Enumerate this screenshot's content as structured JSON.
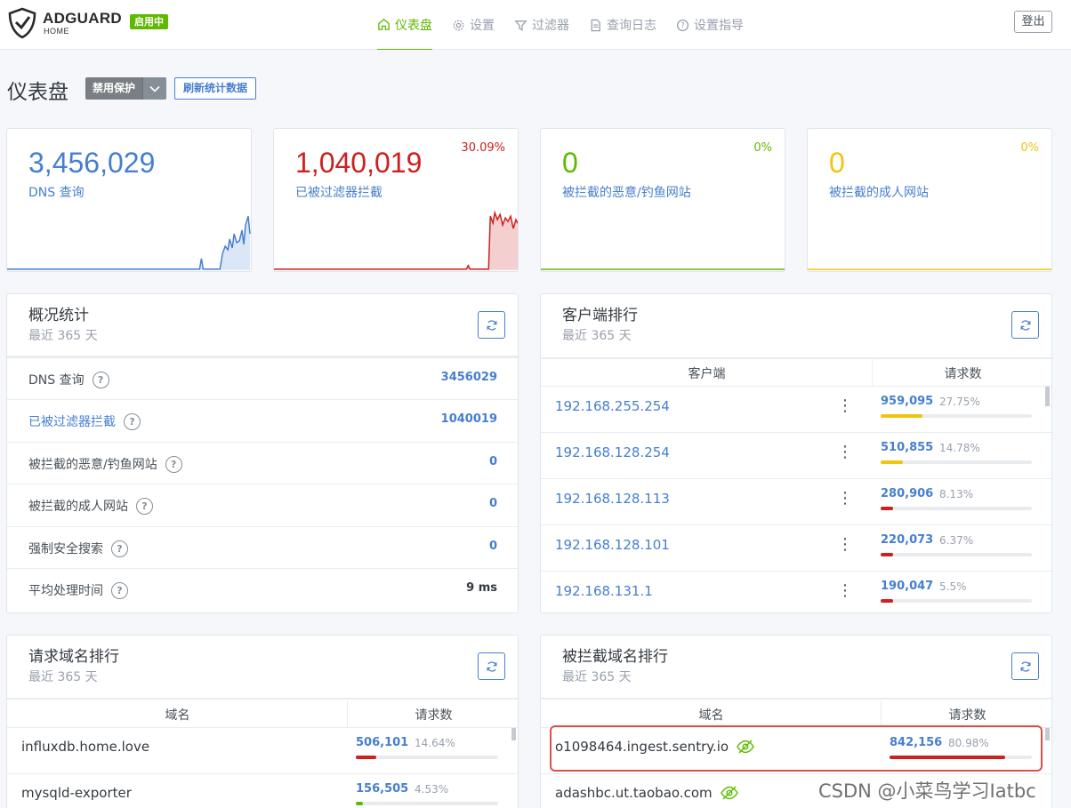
{
  "header": {
    "brand": "ADGUARD",
    "brand_sub": "HOME",
    "status_badge": "启用中",
    "nav": [
      {
        "label": "仪表盘",
        "icon": "home-icon"
      },
      {
        "label": "设置",
        "icon": "gear-icon"
      },
      {
        "label": "过滤器",
        "icon": "filter-icon"
      },
      {
        "label": "查询日志",
        "icon": "log-icon"
      },
      {
        "label": "设置指导",
        "icon": "help-circle-icon"
      }
    ],
    "logout": "登出"
  },
  "page": {
    "title": "仪表盘",
    "disable_button": "禁用保护",
    "refresh_button": "刷新统计数据"
  },
  "stats": [
    {
      "value": "3,456,029",
      "label": "DNS 查询",
      "pct": "",
      "color": "#467fcf"
    },
    {
      "value": "1,040,019",
      "label": "已被过滤器拦截",
      "pct": "30.09%",
      "color": "#cd201f"
    },
    {
      "value": "0",
      "label": "被拦截的恶意/钓鱼网站",
      "pct": "0%",
      "color": "#5eba00"
    },
    {
      "value": "0",
      "label": "被拦截的成人网站",
      "pct": "0%",
      "color": "#f1c40f"
    }
  ],
  "summary": {
    "title": "概况统计",
    "subtitle": "最近 365 天",
    "rows": [
      {
        "label": "DNS 查询",
        "value": "3456029"
      },
      {
        "label": "已被过滤器拦截",
        "value": "1040019"
      },
      {
        "label": "被拦截的恶意/钓鱼网站",
        "value": "0"
      },
      {
        "label": "被拦截的成人网站",
        "value": "0"
      },
      {
        "label": "强制安全搜索",
        "value": "0"
      },
      {
        "label": "平均处理时间",
        "value": "9 ms"
      }
    ]
  },
  "clients": {
    "title": "客户端排行",
    "subtitle": "最近 365 天",
    "col_client": "客户端",
    "col_requests": "请求数",
    "rows": [
      {
        "ip": "192.168.255.254",
        "count": "959,095",
        "pct": "27.75%",
        "ratio": 0.2775,
        "color": "#f1c40f"
      },
      {
        "ip": "192.168.128.254",
        "count": "510,855",
        "pct": "14.78%",
        "ratio": 0.1478,
        "color": "#f1c40f"
      },
      {
        "ip": "192.168.128.113",
        "count": "280,906",
        "pct": "8.13%",
        "ratio": 0.0813,
        "color": "#cd201f"
      },
      {
        "ip": "192.168.128.101",
        "count": "220,073",
        "pct": "6.37%",
        "ratio": 0.0637,
        "color": "#cd201f"
      },
      {
        "ip": "192.168.131.1",
        "count": "190,047",
        "pct": "5.5%",
        "ratio": 0.055,
        "color": "#cd201f"
      }
    ]
  },
  "queried": {
    "title": "请求域名排行",
    "subtitle": "最近 365 天",
    "col_domain": "域名",
    "col_requests": "请求数",
    "rows": [
      {
        "domain": "influxdb.home.love",
        "count": "506,101",
        "pct": "14.64%",
        "ratio": 0.1464,
        "color": "#cd201f"
      },
      {
        "domain": "mysqld-exporter",
        "count": "156,505",
        "pct": "4.53%",
        "ratio": 0.0453,
        "color": "#5eba00"
      }
    ]
  },
  "blocked": {
    "title": "被拦截域名排行",
    "subtitle": "最近 365 天",
    "col_domain": "域名",
    "col_requests": "请求数",
    "rows": [
      {
        "domain": "o1098464.ingest.sentry.io",
        "count": "842,156",
        "pct": "80.98%",
        "ratio": 0.8098,
        "color": "#cd201f"
      },
      {
        "domain": "adashbc.ut.taobao.com",
        "count": "",
        "pct": "",
        "ratio": 0,
        "color": "#cd201f"
      }
    ]
  },
  "watermark": "CSDN @小菜鸟学习Iatbc"
}
